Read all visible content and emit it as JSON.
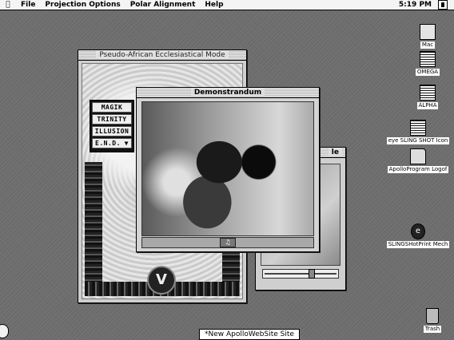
{
  "menubar": {
    "apple_icon": "apple-icon",
    "menus": [
      "File",
      "Projection Options",
      "Polar Alignment",
      "Help"
    ],
    "clock": "5:19 PM",
    "app_icon": "application-menu-icon"
  },
  "windows": {
    "pseudo": {
      "title": "Pseudo-African Ecclesiastical Mode",
      "options": [
        "MAGIK",
        "TRINITY",
        "ILLUSION"
      ],
      "selected": "E.N.D.",
      "selector_arrow": "▼",
      "emblem": "V"
    },
    "demo": {
      "title": "Demonstrandum",
      "volume_icon": "volume-icon"
    },
    "back": {
      "title_fragment": "le",
      "slider_value": 0.65
    }
  },
  "desktop_icons": [
    {
      "label": "Mac",
      "icon": "hard-disk-icon"
    },
    {
      "label": "OMEGA",
      "icon": "stack-document-icon"
    },
    {
      "label": "ALPHA",
      "icon": "stack-document-icon"
    },
    {
      "label": "eye SLING SHOT Icon",
      "icon": "stack-document-icon"
    },
    {
      "label": "ApolloProgram Logof",
      "icon": "folder-icon"
    },
    {
      "label": "SLINGSHotPrint Mech",
      "icon": "pot-icon"
    },
    {
      "label": "Trash",
      "icon": "trash-icon"
    }
  ],
  "taskbar": {
    "label": "*New ApolloWebSite Site"
  }
}
